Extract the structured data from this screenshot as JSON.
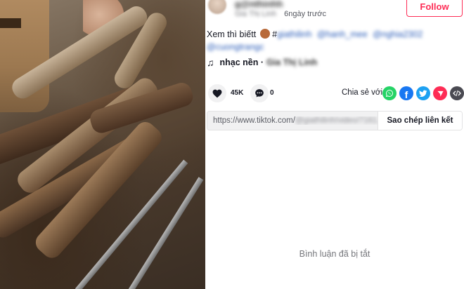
{
  "author": {
    "name": "g@nthinhh",
    "nickname": "Gia Thị Linh",
    "date": "6ngày trước",
    "follow_label": "Follow"
  },
  "caption": {
    "text": "Xem thì biếtt",
    "hash_visible": "#",
    "tags": [
      "giathilinh",
      "@hanh_mee",
      "@nghia2302",
      "@cuongtrangc"
    ]
  },
  "music": {
    "label": "nhạc nền ·",
    "artist": "Gia Thị Linh"
  },
  "actions": {
    "likes": "45K",
    "comments": "0",
    "share_label": "Chia sẻ với"
  },
  "share_icons": [
    {
      "name": "whatsapp-icon",
      "color": "#25d366"
    },
    {
      "name": "facebook-icon",
      "color": "#1877f2"
    },
    {
      "name": "twitter-icon",
      "color": "#1da1f2"
    },
    {
      "name": "send-icon",
      "color": "#fe2c55"
    },
    {
      "name": "embed-icon",
      "color": "#4a4a52"
    }
  ],
  "copy_link": {
    "url_prefix": "https://www.tiktok.com/",
    "url_rest": "@giathilinh/video/7161...",
    "button_label": "Sao chép liên kết"
  },
  "comments_status": "Bình luận đã bị tắt",
  "colors": {
    "accent": "#fe2c55",
    "text": "#161823",
    "muted": "#75767b"
  }
}
